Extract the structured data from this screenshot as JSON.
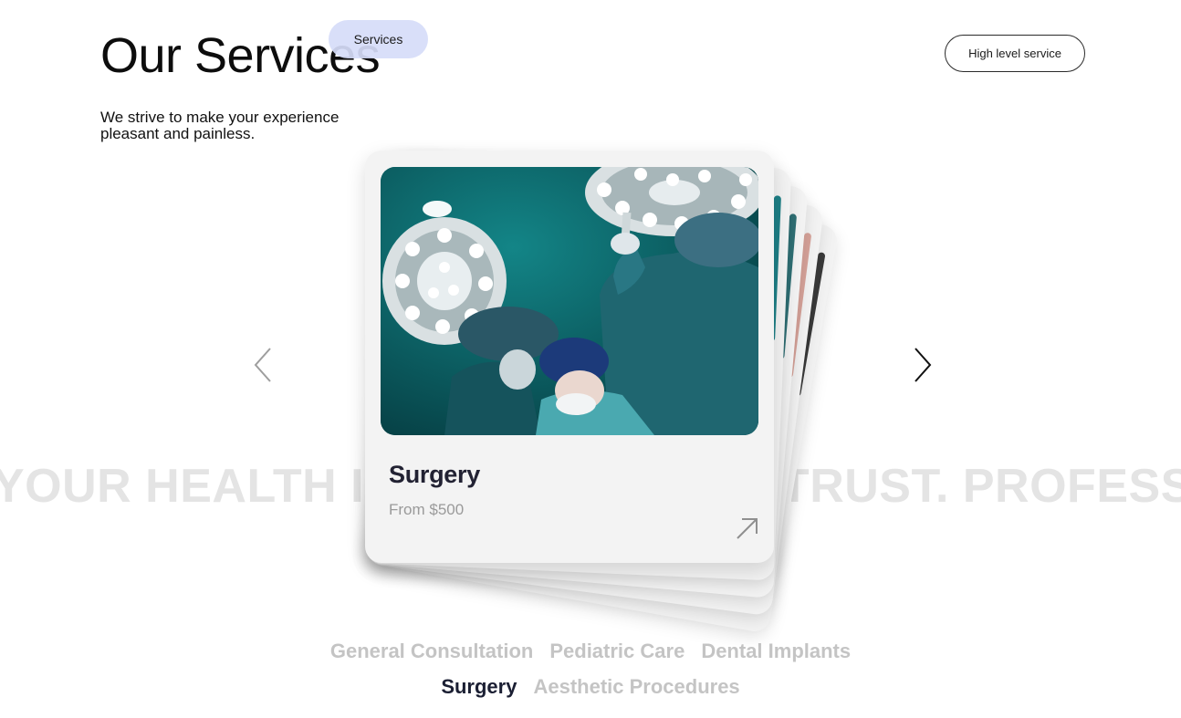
{
  "header": {
    "title": "Our Services",
    "pill_label": "Services",
    "cta_label": "High level service",
    "tagline": "We strive to make your experience pleasant and painless."
  },
  "marquee": {
    "text": "YOUR HEALTH IS OUR PRIORITY. TRUST. PROFESSIONALISM."
  },
  "carousel": {
    "prev_icon": "chevron-left-icon",
    "next_icon": "chevron-right-icon",
    "active_card": {
      "title": "Surgery",
      "price": "From $500",
      "link_icon": "arrow-up-right-icon",
      "image": "surgeons-operating-room-photo"
    },
    "back_card_accents": [
      "#3a3a3a",
      "#d7a39a",
      "#2f6f74",
      "#1d7f86"
    ]
  },
  "tabs": {
    "row1": [
      "General Consultation",
      "Pediatric Care",
      "Dental Implants"
    ],
    "row2": [
      "Surgery",
      "Aesthetic Procedures"
    ],
    "active": "Surgery"
  },
  "colors": {
    "pill_bg": "#d6dcf8",
    "card_bg": "#f3f3f3",
    "active_tab": "#1b1f33",
    "inactive_tab": "#c4c4c4",
    "marquee": "#e4e4e4"
  }
}
